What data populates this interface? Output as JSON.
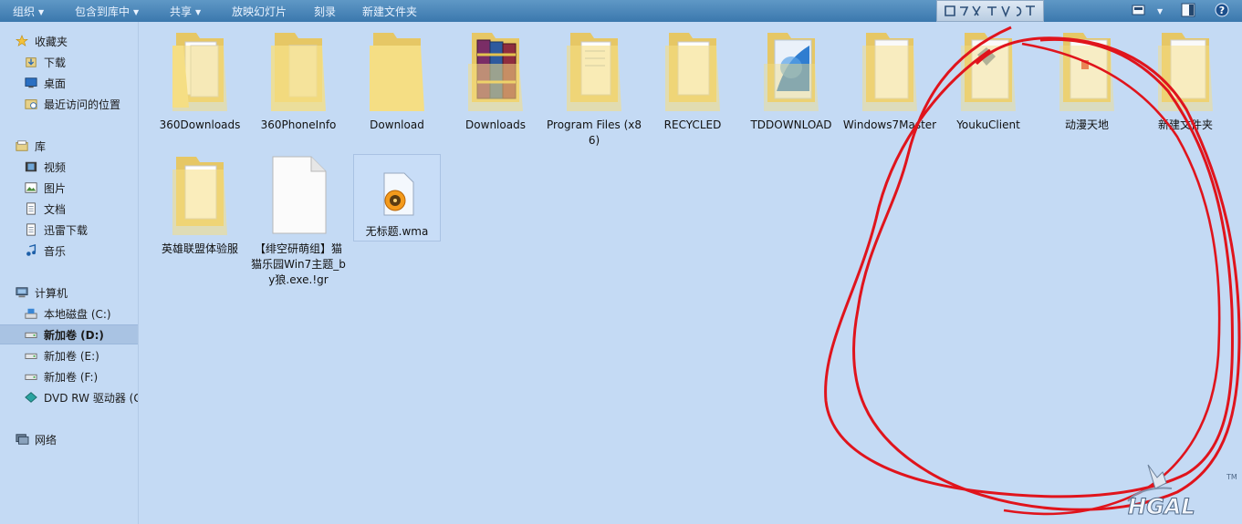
{
  "toolbar": {
    "organize": "组织",
    "include_library": "包含到库中",
    "share": "共享",
    "slideshow": "放映幻灯片",
    "burn": "刻录",
    "new_folder": "新建文件夹"
  },
  "nav": {
    "favorites": "收藏夹",
    "downloads": "下载",
    "desktop": "桌面",
    "recent": "最近访问的位置",
    "libraries": "库",
    "videos": "视频",
    "pictures": "图片",
    "documents": "文档",
    "thunder": "迅雷下载",
    "music": "音乐",
    "computer": "计算机",
    "drive_c": "本地磁盘 (C:)",
    "drive_d": "新加卷 (D:)",
    "drive_e": "新加卷 (E:)",
    "drive_f": "新加卷 (F:)",
    "dvd": "DVD RW 驱动器 (G",
    "network": "网络"
  },
  "files": [
    {
      "name": "360Downloads",
      "kind": "folder"
    },
    {
      "name": "360PhoneInfo",
      "kind": "folder"
    },
    {
      "name": "Download",
      "kind": "folder"
    },
    {
      "name": "Downloads",
      "kind": "folder-books"
    },
    {
      "name": "Program Files (x86)",
      "kind": "folder"
    },
    {
      "name": "RECYCLED",
      "kind": "folder"
    },
    {
      "name": "TDDOWNLOAD",
      "kind": "folder-blue"
    },
    {
      "name": "Windows7Master",
      "kind": "folder-white"
    },
    {
      "name": "YoukuClient",
      "kind": "folder-white"
    },
    {
      "name": "动漫天地",
      "kind": "folder-doc"
    },
    {
      "name": "新建文件夹",
      "kind": "folder-white"
    },
    {
      "name": "英雄联盟体验服",
      "kind": "folder"
    },
    {
      "name": "【绯空研萌组】猫猫乐园Win7主题_by狼.exe.!gr",
      "kind": "file-blank"
    },
    {
      "name": "无标题.wma",
      "kind": "file-wma"
    }
  ],
  "colors": {
    "toolbar": "#3f7cb1",
    "background": "#c4daf4",
    "annotation": "#e0141c"
  }
}
